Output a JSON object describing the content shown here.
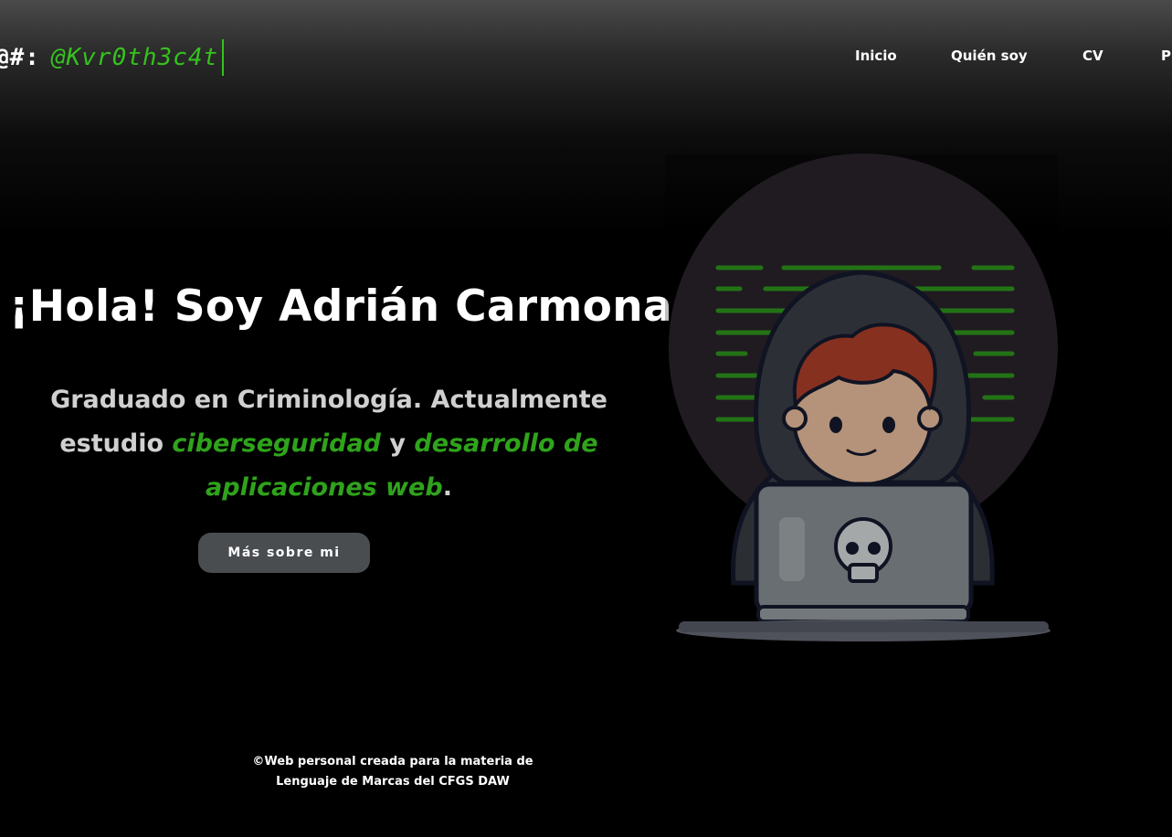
{
  "header": {
    "prompt": "@#:",
    "handle": "@Kvr0th3c4t"
  },
  "nav": {
    "items": [
      {
        "label": "Inicio"
      },
      {
        "label": "Quién soy"
      },
      {
        "label": "CV"
      },
      {
        "label": "P"
      }
    ]
  },
  "hero": {
    "title": "¡Hola! Soy Adrián Carmona",
    "desc_part1": "Graduado en Criminología. Actualmente estudio ",
    "desc_hl1": "ciberseguridad",
    "desc_part2": " y ",
    "desc_hl2": "desarrollo de aplicaciones web",
    "desc_part3": ".",
    "button_label": "Más sobre mi"
  },
  "illustration": {
    "icon": "hooded-hacker-laptop-skull-icon"
  },
  "footer": {
    "line1": "©Web personal creada para la materia de",
    "line2": "Lenguaje de Marcas del CFGS DAW"
  },
  "colors": {
    "accent_green": "#35c21d",
    "text_green": "#2fa31b",
    "button_bg": "#4a4d50"
  }
}
